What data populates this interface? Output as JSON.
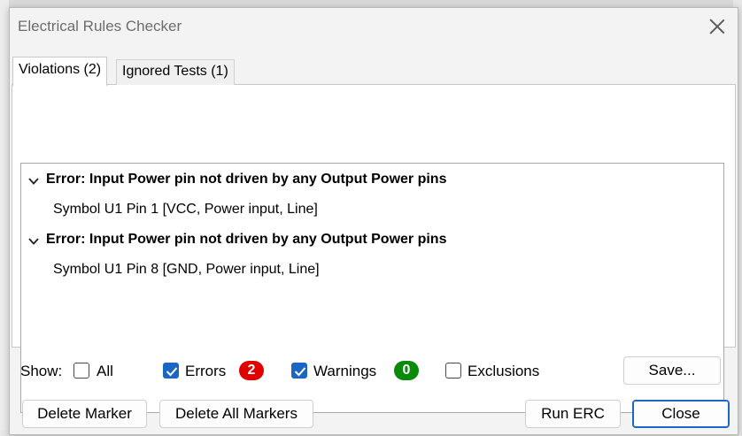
{
  "window": {
    "title": "Electrical Rules Checker"
  },
  "tabs": [
    {
      "label": "Violations (2)",
      "active": true
    },
    {
      "label": "Ignored Tests (1)",
      "active": false
    }
  ],
  "violations": [
    {
      "heading": "Error: Input Power pin not driven by any Output Power pins",
      "detail": "Symbol U1 Pin 1 [VCC, Power input, Line]"
    },
    {
      "heading": "Error: Input Power pin not driven by any Output Power pins",
      "detail": "Symbol U1 Pin 8 [GND, Power input, Line]"
    }
  ],
  "filters": {
    "show_label": "Show:",
    "all": {
      "label": "All",
      "checked": false
    },
    "errors": {
      "label": "Errors",
      "checked": true,
      "count": "2",
      "color": "#e00000"
    },
    "warnings": {
      "label": "Warnings",
      "checked": true,
      "count": "0",
      "color": "#0a8a0a"
    },
    "exclusions": {
      "label": "Exclusions",
      "checked": false
    }
  },
  "buttons": {
    "save": "Save...",
    "delete_marker": "Delete Marker",
    "delete_all_markers": "Delete All Markers",
    "run_erc": "Run ERC",
    "close": "Close"
  },
  "colors": {
    "accent": "#1a66c2"
  }
}
